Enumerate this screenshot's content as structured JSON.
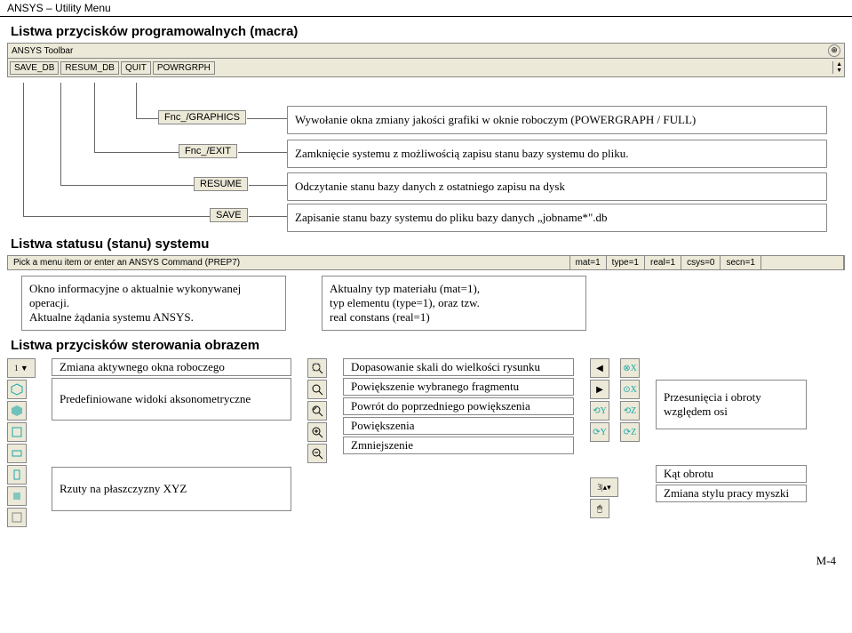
{
  "header": {
    "title": "ANSYS – Utility Menu"
  },
  "sections": {
    "macros_title": "Listwa przycisków programowalnych (macra)",
    "status_title": "Listwa statusu (stanu) systemu",
    "image_ctrl_title": "Listwa przycisków sterowania obrazem"
  },
  "ansys_toolbar": {
    "label": "ANSYS Toolbar",
    "buttons": [
      "SAVE_DB",
      "RESUM_DB",
      "QUIT",
      "POWRGRPH"
    ]
  },
  "fnc_rows": [
    {
      "label": "Fnc_/GRAPHICS",
      "desc": "Wywołanie okna zmiany jakości grafiki w oknie roboczym (POWERGRAPH / FULL)"
    },
    {
      "label": "Fnc_/EXIT",
      "desc": "Zamknięcie systemu z możliwością zapisu stanu bazy systemu do pliku."
    },
    {
      "label": "RESUME",
      "desc": "Odczytanie stanu bazy danych z ostatniego zapisu na dysk"
    },
    {
      "label": "SAVE",
      "desc": "Zapisanie stanu bazy systemu do pliku bazy danych „jobname*\".db"
    }
  ],
  "status_bar": {
    "prompt": "Pick a menu item or enter an ANSYS Command (PREP7)",
    "fields": [
      "mat=1",
      "type=1",
      "real=1",
      "csys=0",
      "secn=1"
    ]
  },
  "status_info": {
    "left": "Okno informacyjne o aktualnie wykonywanej operacji.\nAktualne żądania systemu ANSYS.",
    "right": "Aktualny typ materiału (mat=1),\ntyp elementu (type=1), oraz tzw.\nreal constans (real=1)"
  },
  "image_controls": {
    "col1_labels": [
      "Zmiana aktywnego okna roboczego",
      "Predefiniowane widoki aksonometryczne"
    ],
    "col1_lower": "Rzuty na płaszczyzny XYZ",
    "col2_labels": [
      "Dopasowanie skali do wielkości rysunku",
      "Powiększenie wybranego fragmentu",
      "Powrót do poprzedniego powiększenia",
      "Powiększenia",
      "Zmniejszenie"
    ],
    "col3_label": "Przesunięcia i obroty względem osi",
    "col3_lower": [
      "Kąt obrotu",
      "Zmiana stylu pracy myszki"
    ]
  },
  "footer": {
    "page": "M-4"
  }
}
